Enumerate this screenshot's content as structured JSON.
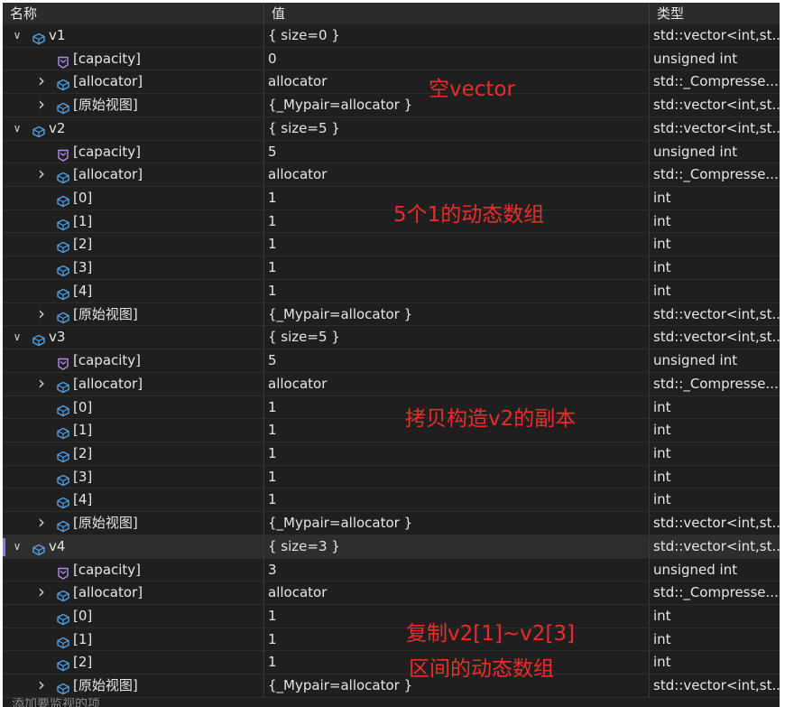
{
  "header": {
    "name": "名称",
    "value": "值",
    "type": "类型"
  },
  "rows": [
    {
      "level": 0,
      "expander": "open",
      "icon": "var",
      "name": "v1",
      "value": "{ size=0 }",
      "type": "std::vector<int,st..."
    },
    {
      "level": 1,
      "expander": "none",
      "icon": "prop",
      "name": "[capacity]",
      "value": "0",
      "type": "unsigned int"
    },
    {
      "level": 1,
      "expander": "closed",
      "icon": "var",
      "name": "[allocator]",
      "value": "allocator",
      "type": "std::_Compresse..."
    },
    {
      "level": 1,
      "expander": "closed",
      "icon": "var",
      "name": "[原始视图]",
      "value": "{_Mypair=allocator }",
      "type": "std::vector<int,st..."
    },
    {
      "level": 0,
      "expander": "open",
      "icon": "var",
      "name": "v2",
      "value": "{ size=5 }",
      "type": "std::vector<int,st..."
    },
    {
      "level": 1,
      "expander": "none",
      "icon": "prop",
      "name": "[capacity]",
      "value": "5",
      "type": "unsigned int"
    },
    {
      "level": 1,
      "expander": "closed",
      "icon": "var",
      "name": "[allocator]",
      "value": "allocator",
      "type": "std::_Compresse..."
    },
    {
      "level": 1,
      "expander": "none",
      "icon": "var",
      "name": "[0]",
      "value": "1",
      "type": "int"
    },
    {
      "level": 1,
      "expander": "none",
      "icon": "var",
      "name": "[1]",
      "value": "1",
      "type": "int"
    },
    {
      "level": 1,
      "expander": "none",
      "icon": "var",
      "name": "[2]",
      "value": "1",
      "type": "int"
    },
    {
      "level": 1,
      "expander": "none",
      "icon": "var",
      "name": "[3]",
      "value": "1",
      "type": "int"
    },
    {
      "level": 1,
      "expander": "none",
      "icon": "var",
      "name": "[4]",
      "value": "1",
      "type": "int"
    },
    {
      "level": 1,
      "expander": "closed",
      "icon": "var",
      "name": "[原始视图]",
      "value": "{_Mypair=allocator }",
      "type": "std::vector<int,st..."
    },
    {
      "level": 0,
      "expander": "open",
      "icon": "var",
      "name": "v3",
      "value": "{ size=5 }",
      "type": "std::vector<int,st..."
    },
    {
      "level": 1,
      "expander": "none",
      "icon": "prop",
      "name": "[capacity]",
      "value": "5",
      "type": "unsigned int"
    },
    {
      "level": 1,
      "expander": "closed",
      "icon": "var",
      "name": "[allocator]",
      "value": "allocator",
      "type": "std::_Compresse..."
    },
    {
      "level": 1,
      "expander": "none",
      "icon": "var",
      "name": "[0]",
      "value": "1",
      "type": "int"
    },
    {
      "level": 1,
      "expander": "none",
      "icon": "var",
      "name": "[1]",
      "value": "1",
      "type": "int"
    },
    {
      "level": 1,
      "expander": "none",
      "icon": "var",
      "name": "[2]",
      "value": "1",
      "type": "int"
    },
    {
      "level": 1,
      "expander": "none",
      "icon": "var",
      "name": "[3]",
      "value": "1",
      "type": "int"
    },
    {
      "level": 1,
      "expander": "none",
      "icon": "var",
      "name": "[4]",
      "value": "1",
      "type": "int"
    },
    {
      "level": 1,
      "expander": "closed",
      "icon": "var",
      "name": "[原始视图]",
      "value": "{_Mypair=allocator }",
      "type": "std::vector<int,st..."
    },
    {
      "level": 0,
      "expander": "open",
      "icon": "var",
      "name": "v4",
      "value": "{ size=3 }",
      "type": "std::vector<int,st...",
      "selected": true
    },
    {
      "level": 1,
      "expander": "none",
      "icon": "prop",
      "name": "[capacity]",
      "value": "3",
      "type": "unsigned int"
    },
    {
      "level": 1,
      "expander": "closed",
      "icon": "var",
      "name": "[allocator]",
      "value": "allocator",
      "type": "std::_Compresse..."
    },
    {
      "level": 1,
      "expander": "none",
      "icon": "var",
      "name": "[0]",
      "value": "1",
      "type": "int"
    },
    {
      "level": 1,
      "expander": "none",
      "icon": "var",
      "name": "[1]",
      "value": "1",
      "type": "int"
    },
    {
      "level": 1,
      "expander": "none",
      "icon": "var",
      "name": "[2]",
      "value": "1",
      "type": "int"
    },
    {
      "level": 1,
      "expander": "closed",
      "icon": "var",
      "name": "[原始视图]",
      "value": "{_Mypair=allocator }",
      "type": "std::vector<int,st..."
    }
  ],
  "footer": "添加要监视的项",
  "annotations": {
    "a1": "空vector",
    "a2": "5个1的动态数组",
    "a3": "拷贝构造v2的副本",
    "a4_line1": "复制v2[1]~v2[3]",
    "a4_line2": "区间的动态数组"
  },
  "colors": {
    "annotation": "#ee2a2a",
    "var_icon": "#4fa3e8",
    "prop_icon": "#b18be8",
    "selection_marker": "#8a7cf0"
  }
}
